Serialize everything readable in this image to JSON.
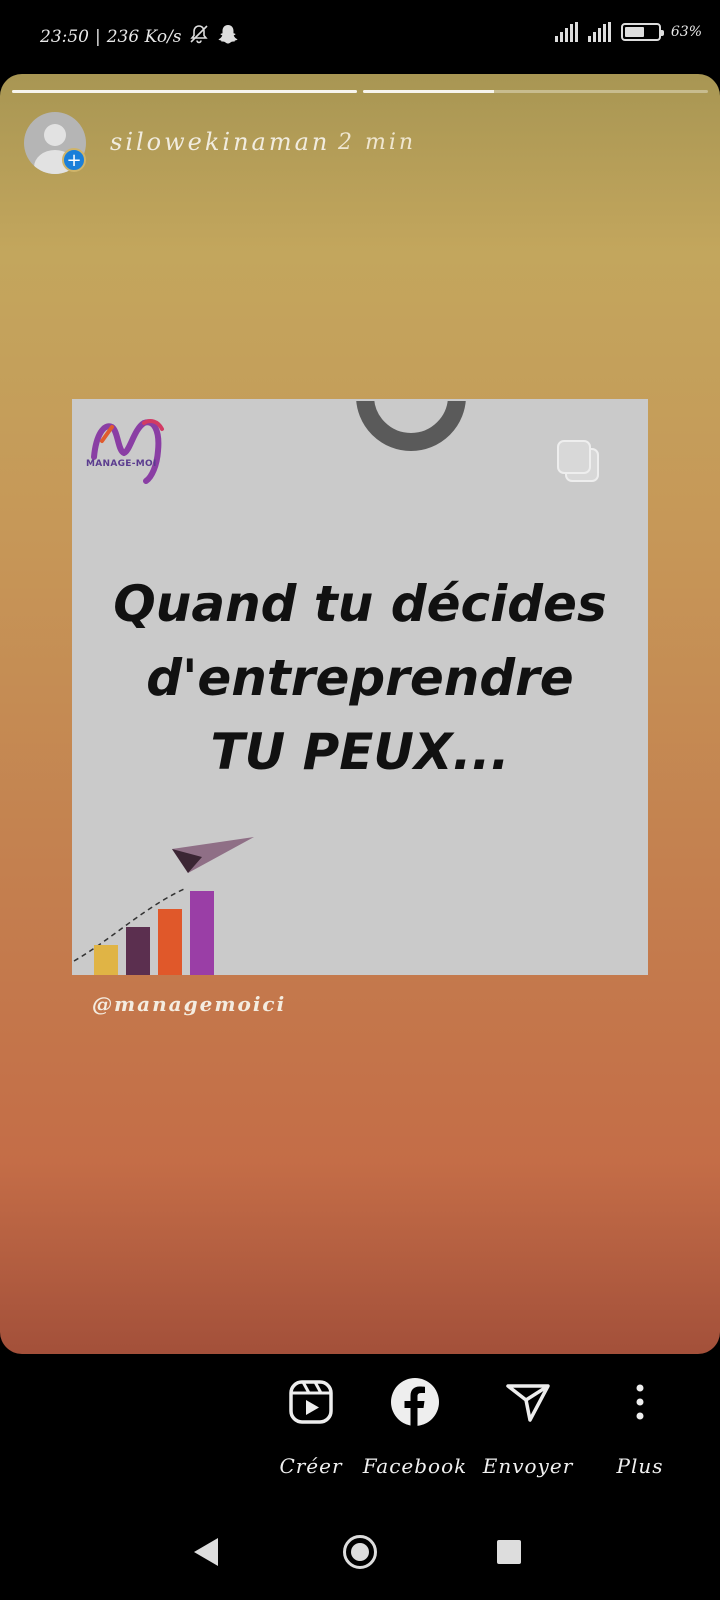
{
  "status_bar": {
    "time": "23:50",
    "speed": "236 Ko/s",
    "battery_percent": 63,
    "battery_label": "63%",
    "bell_icon": "muted-bell-icon",
    "app_icon": "snapchat-ghost-icon"
  },
  "story": {
    "progress_segments": [
      1.0,
      0.38
    ],
    "username": "silowekinaman",
    "time_ago": "2 min",
    "post": {
      "logo_text": "MANAGE-MOI",
      "headline_line1": "Quand tu décides",
      "headline_line2": "d'entreprendre",
      "headline_line3": "TU PEUX...",
      "bar_colors": [
        "#e0b445",
        "#5b2f4f",
        "#e0582a",
        "#9a3ea6"
      ]
    },
    "handle": "@managemoici"
  },
  "share_bar": {
    "items": [
      {
        "label": "Créer",
        "icon": "reels-icon"
      },
      {
        "label": "Facebook",
        "icon": "facebook-icon"
      },
      {
        "label": "Envoyer",
        "icon": "paper-plane-icon"
      },
      {
        "label": "Plus",
        "icon": "more-vertical-icon"
      }
    ]
  },
  "colors": {
    "add_badge": "#1a7fd9",
    "story_top": "#a89653",
    "story_bottom": "#a3503a"
  }
}
